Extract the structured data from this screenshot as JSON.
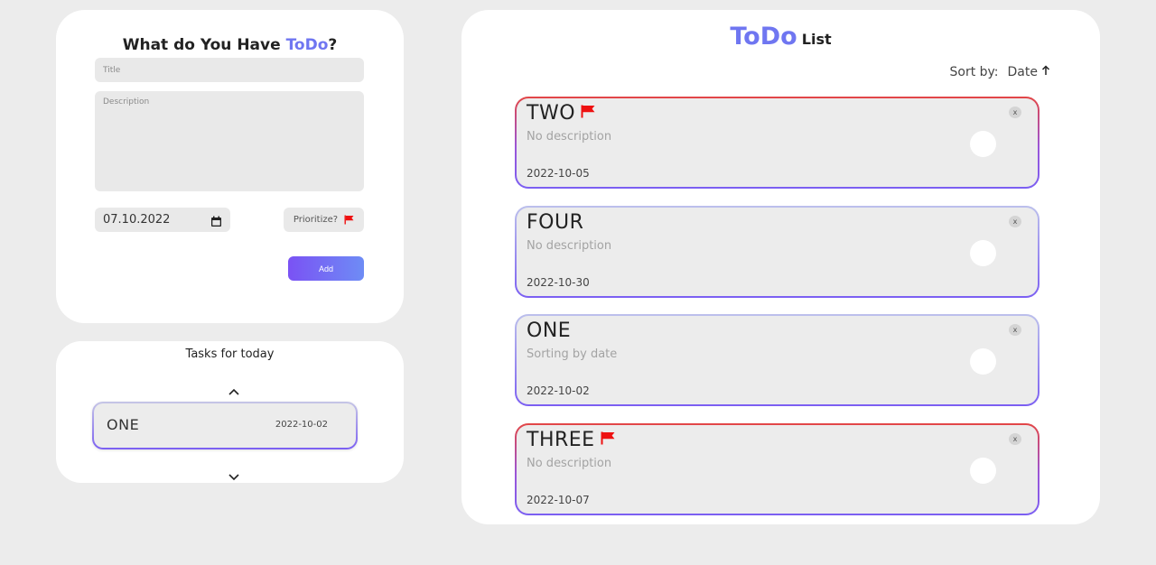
{
  "form": {
    "heading_prefix": "What do You Have ",
    "heading_brand": "ToDo",
    "heading_suffix": "?",
    "title_placeholder": "Title",
    "description_placeholder": "Description",
    "date_value": "07.10.2022",
    "prioritize_label": "Prioritize?",
    "add_label": "Add"
  },
  "today": {
    "title": "Tasks for today",
    "items": [
      {
        "name": "ONE",
        "date": "2022-10-02"
      }
    ]
  },
  "list": {
    "title_brand": "ToDo",
    "title_word": "List",
    "sort_label": "Sort by:",
    "sort_value": "Date",
    "sort_direction_icon": "arrow-up-icon",
    "items": [
      {
        "name": "TWO",
        "description": "No description",
        "date": "2022-10-05",
        "priority": true,
        "close_label": "x"
      },
      {
        "name": "FOUR",
        "description": "No description",
        "date": "2022-10-30",
        "priority": false,
        "close_label": "x"
      },
      {
        "name": "ONE",
        "description": "Sorting by date",
        "date": "2022-10-02",
        "priority": false,
        "close_label": "x"
      },
      {
        "name": "THREE",
        "description": "No description",
        "date": "2022-10-07",
        "priority": true,
        "close_label": "x"
      }
    ]
  },
  "colors": {
    "background": "#ececec",
    "card": "#ffffff",
    "brand": "#6f76f1",
    "accent_gradient_start": "#7a52f4",
    "accent_gradient_end": "#6e8cf5",
    "priority_border": "#e34646",
    "flag": "#ee1111"
  }
}
